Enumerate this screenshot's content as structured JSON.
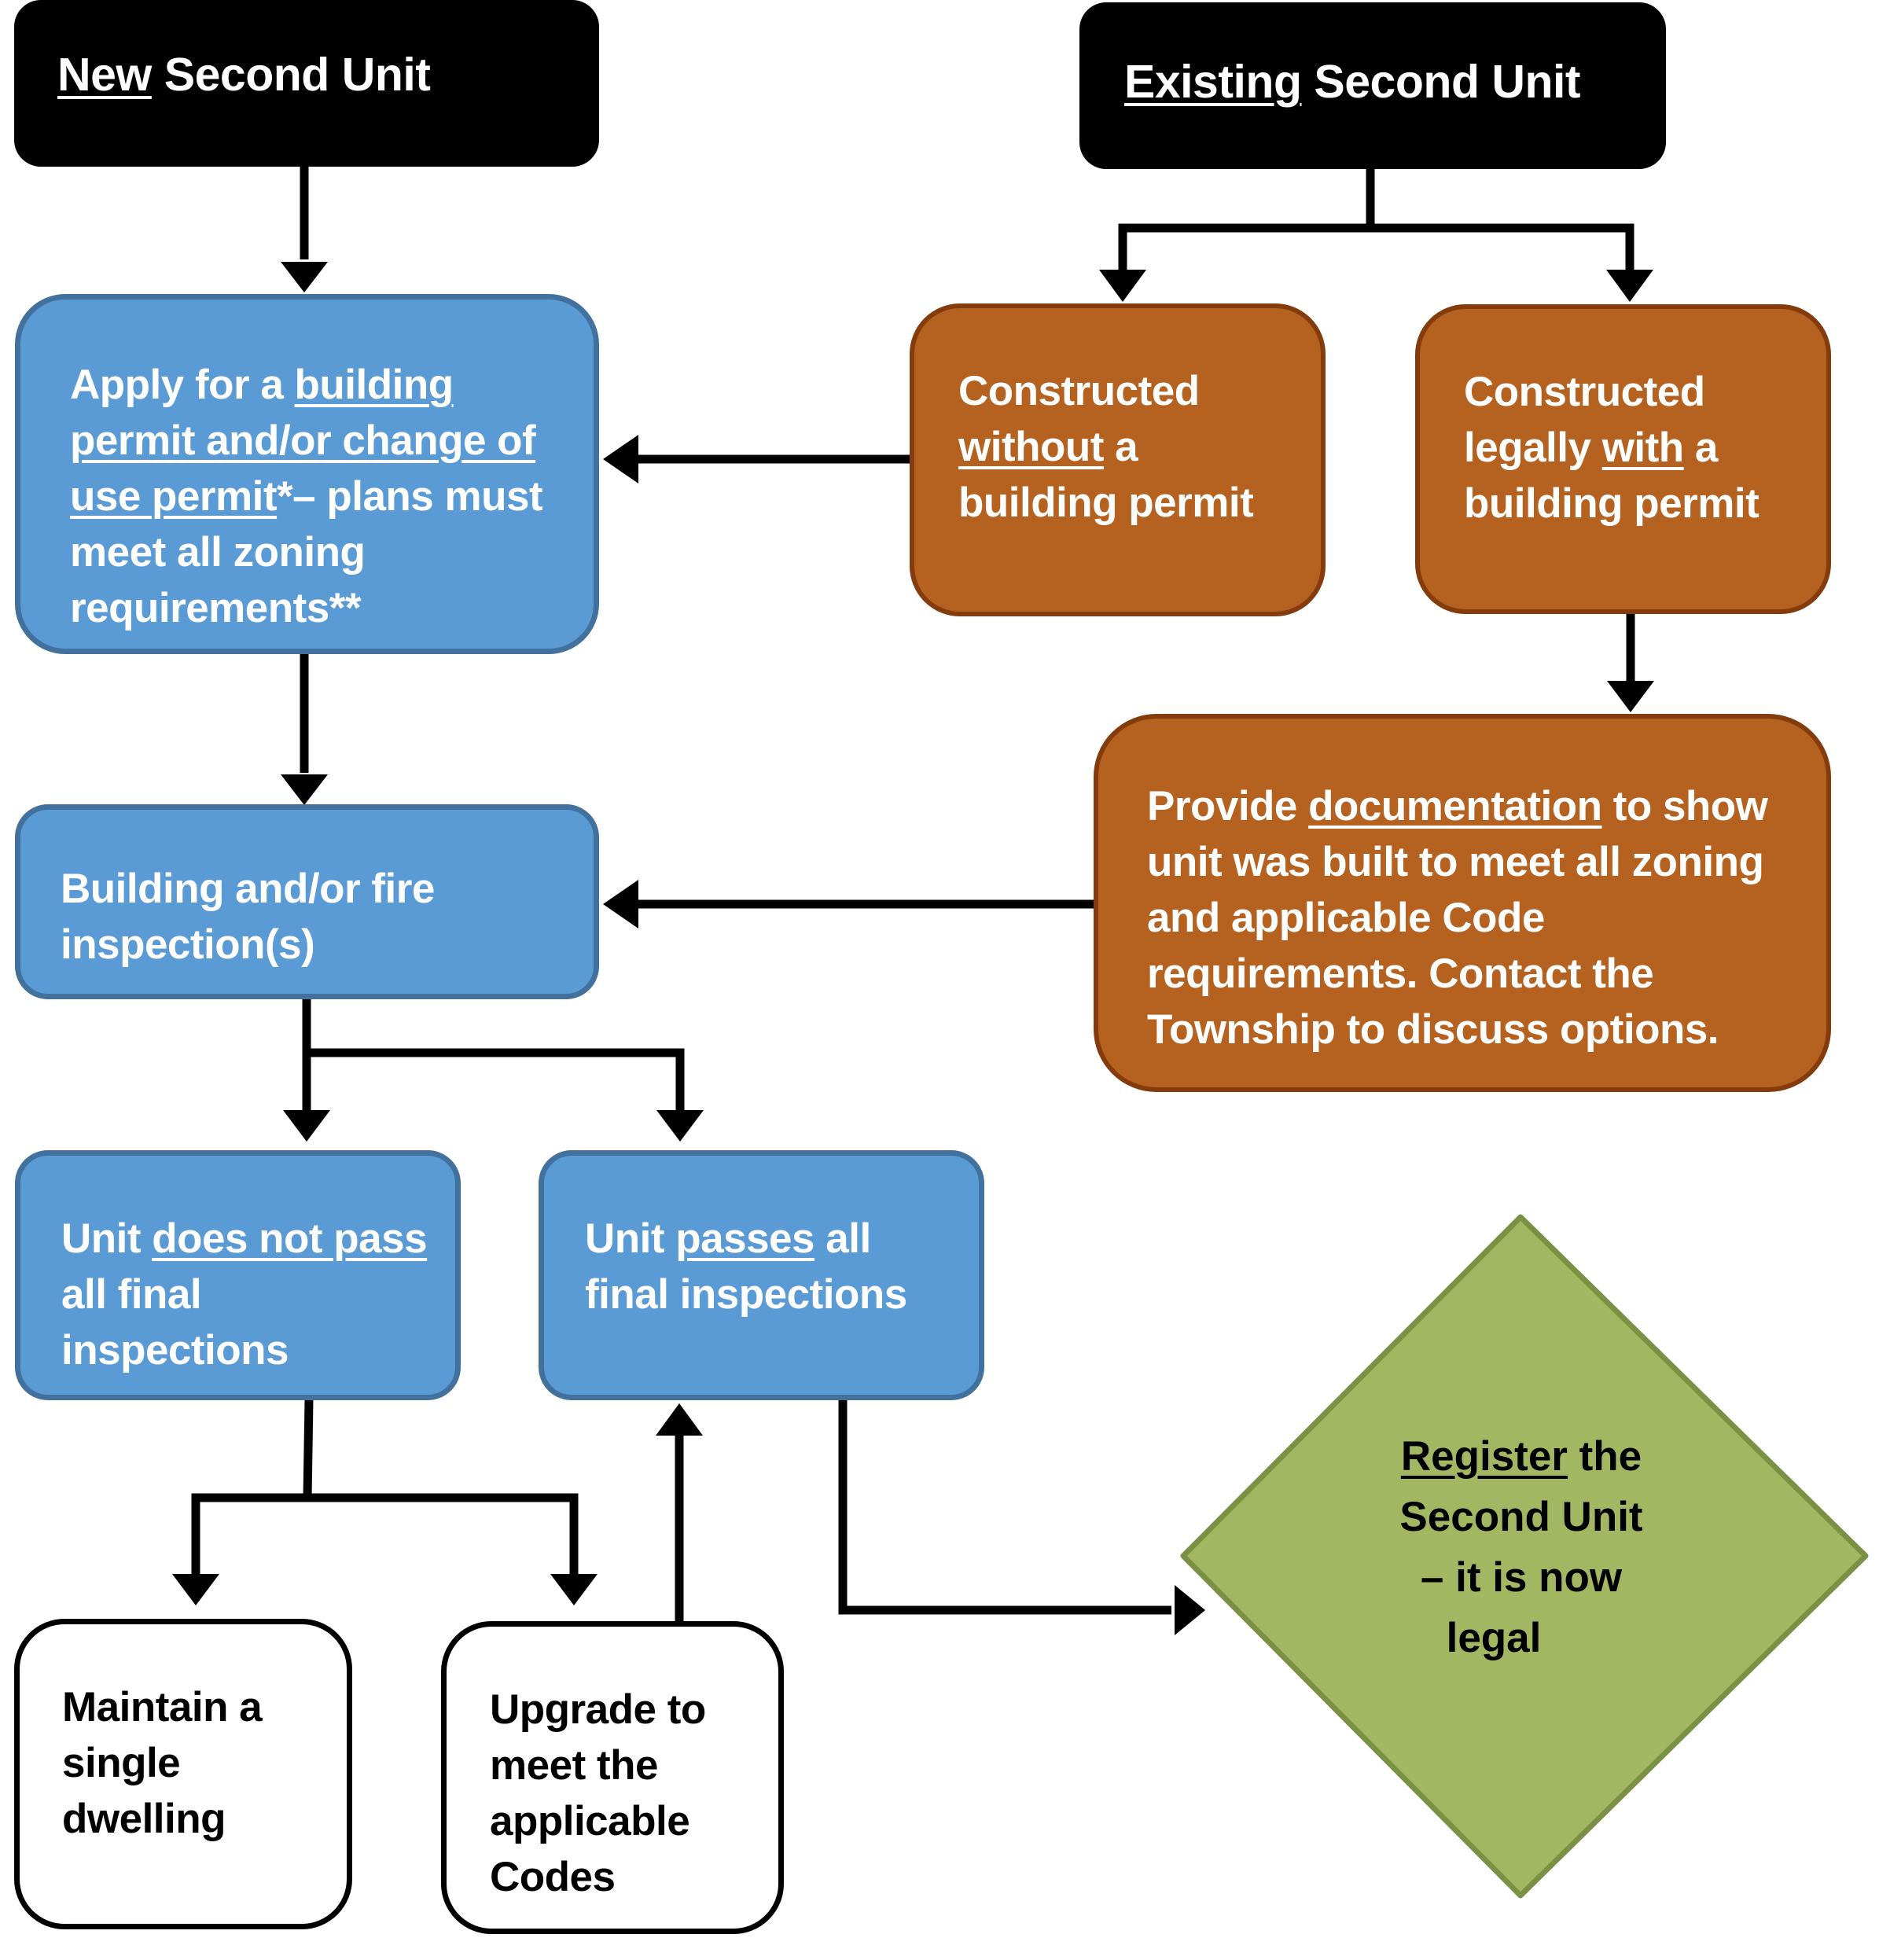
{
  "title": "Second Unit registration flowchart",
  "colors": {
    "header": "#000000",
    "blue_fill": "#5b9bd5",
    "blue_border": "#41719c",
    "orange_fill": "#b5611f",
    "orange_border": "#843c0c",
    "green_fill": "#a3b763",
    "green_border": "#7a9144",
    "arrow": "#000000"
  },
  "nodes": {
    "new_unit": {
      "u": "New",
      "rest": " Second Unit"
    },
    "existing_unit": {
      "u": "Existing",
      "rest": " Second Unit"
    },
    "apply_permit": {
      "pre": "Apply for a ",
      "u": "building permit and/or change of use permit",
      "post": "*– plans must meet all zoning requirements**"
    },
    "without_permit": {
      "pre": "Constructed ",
      "u": "without",
      "post": " a building permit"
    },
    "with_permit": {
      "pre": "Constructed legally ",
      "u": "with",
      "post": " a building permit"
    },
    "documentation": {
      "pre": "Provide ",
      "u": "documentation",
      "post": " to show unit was built to meet all zoning and applicable Code requirements. Contact the Township to discuss options."
    },
    "inspection": {
      "text": "Building and/or fire inspection(s)"
    },
    "not_pass": {
      "pre": "Unit ",
      "u": "does not pass",
      "post": " all final inspections"
    },
    "passes": {
      "pre": "Unit ",
      "u": "passes",
      "post": " all final inspections"
    },
    "single_dwelling": {
      "text": "Maintain a single dwelling"
    },
    "upgrade": {
      "text": "Upgrade to meet the applicable Codes"
    },
    "register": {
      "u": "Register",
      "line1_rest": " the",
      "line2": "Second Unit",
      "line3": "– it is now",
      "line4": "legal"
    }
  }
}
